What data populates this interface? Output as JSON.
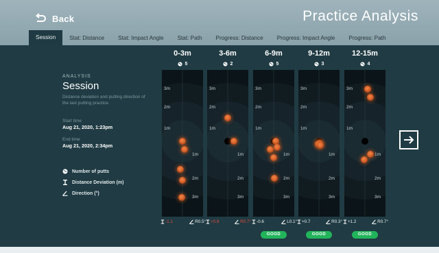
{
  "header": {
    "back_label": "Back",
    "title": "Practice Analysis"
  },
  "tabs": [
    {
      "label": "Session",
      "active": true
    },
    {
      "label": "Stat: Distance"
    },
    {
      "label": "Stat: Impact Angle"
    },
    {
      "label": "Stat: Path"
    },
    {
      "label": "Progress: Distance"
    },
    {
      "label": "Progress: Impact Angle"
    },
    {
      "label": "Progress: Path"
    }
  ],
  "info": {
    "section_label": "ANALYSIS",
    "title": "Session",
    "description": "Distance deviation and putting direction of the last putting practice.",
    "start_label": "Start time",
    "start_value": "Aug 21, 2020, 1:23pm",
    "end_label": "End time",
    "end_value": "Aug 21, 2020, 2:34pm",
    "legend": [
      {
        "icon": "putts-icon",
        "label": "Number of putts"
      },
      {
        "icon": "distance-deviation-icon",
        "label": "Distance Deviation (m)"
      },
      {
        "icon": "direction-angle-icon",
        "label": "Direction (°)"
      }
    ]
  },
  "ring_labels": [
    "3m",
    "2m",
    "1m",
    "1m",
    "2m",
    "3m"
  ],
  "columns": [
    {
      "range": "0-3m",
      "putts": "5",
      "distance": "-1.1",
      "distance_red": true,
      "direction": "R0.5°",
      "direction_red": false,
      "good": false,
      "good_label": "",
      "balls": [
        [
          0.5,
          0.487
        ],
        [
          0.55,
          0.542
        ],
        [
          0.45,
          0.678
        ],
        [
          0.5,
          0.752
        ],
        [
          0.483,
          0.869
        ]
      ]
    },
    {
      "range": "3-6m",
      "putts": "2",
      "distance": "+0.9",
      "distance_red": true,
      "direction": "R0.7°",
      "direction_red": true,
      "good": false,
      "good_label": "",
      "balls": [
        [
          0.5,
          0.327
        ],
        [
          0.65,
          0.486
        ]
      ]
    },
    {
      "range": "6-9m",
      "putts": "5",
      "distance": "-0.6",
      "distance_red": false,
      "direction": "L0.1°",
      "direction_red": false,
      "good": true,
      "good_label": "GOOD",
      "balls": [
        [
          0.55,
          0.486
        ],
        [
          0.42,
          0.543
        ],
        [
          0.58,
          0.528
        ],
        [
          0.5,
          0.6
        ],
        [
          0.52,
          0.738
        ]
      ]
    },
    {
      "range": "9-12m",
      "putts": "3",
      "distance": "+0.7",
      "distance_red": false,
      "direction": "R0.3°",
      "direction_red": false,
      "good": true,
      "good_label": "GOOD",
      "balls": [
        [
          0.52,
          0.5
        ],
        [
          0.49,
          0.505
        ],
        [
          0.54,
          0.512
        ]
      ]
    },
    {
      "range": "12-15m",
      "putts": "4",
      "distance": "+1.2",
      "distance_red": false,
      "direction": "R0.7°",
      "direction_red": false,
      "good": true,
      "good_label": "GOOD",
      "balls": [
        [
          0.57,
          0.13
        ],
        [
          0.63,
          0.185
        ],
        [
          0.48,
          0.61
        ],
        [
          0.63,
          0.575
        ]
      ]
    }
  ],
  "colors": {
    "background": "#203b43",
    "topbar": "#9fb3bb",
    "ball": "#e2712f",
    "good": "#22b45b",
    "bad": "#e04a3e"
  }
}
